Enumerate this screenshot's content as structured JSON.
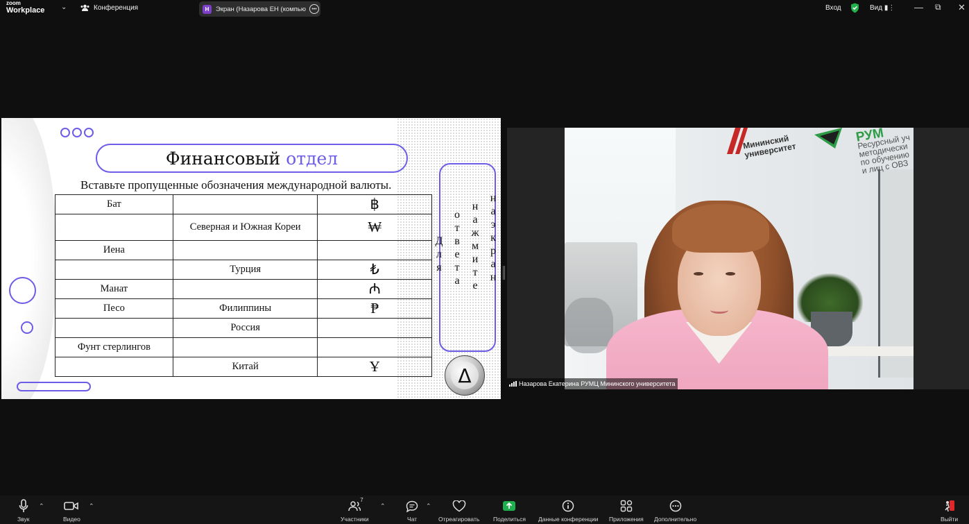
{
  "app": {
    "logo_line1": "zoom",
    "logo_line2": "Workplace",
    "meeting_label": "Конференция",
    "share_tab_letter": "H",
    "share_tab_title": "Экран (Назарова ЕН (компьютер",
    "login_label": "Вход",
    "view_label": "Вид"
  },
  "slide": {
    "title_main": "Финансовый",
    "title_accent": "отдел",
    "subtitle": "Вставьте пропущенные обозначения международной валюты.",
    "rows": [
      {
        "currency": "Бат",
        "country": "",
        "symbol": "฿"
      },
      {
        "currency": "",
        "country": "Северная и Южная Кореи",
        "symbol": "₩"
      },
      {
        "currency": "Иена",
        "country": "",
        "symbol": ""
      },
      {
        "currency": "",
        "country": "Турция",
        "symbol": "₺"
      },
      {
        "currency": "Манат",
        "country": "",
        "symbol": "₼"
      },
      {
        "currency": "Песо",
        "country": "Филиппины",
        "symbol": "₱"
      },
      {
        "currency": "",
        "country": "Россия",
        "symbol": ""
      },
      {
        "currency": "Фунт стерлингов",
        "country": "",
        "symbol": ""
      },
      {
        "currency": "",
        "country": "Китай",
        "symbol": "Ұ"
      }
    ],
    "vertical_words": [
      "Для",
      "ответа",
      "нажмите",
      "на экран"
    ],
    "control_symbol": "Δ",
    "accent_color": "#6c5ce7"
  },
  "video": {
    "participant_name": "Назарова Екатерина РУМЦ Мининского университета",
    "logo_mu_line1": "Мининский",
    "logo_mu_line2": "университет",
    "logo_ruk_big": "РУМ",
    "logo_ruk_lines": [
      "Ресурсный уч",
      "методически",
      "по обучению",
      "и лиц с ОВЗ"
    ]
  },
  "toolbar": {
    "audio": "Звук",
    "video": "Видео",
    "participants": "Участники",
    "participants_count": "7",
    "chat": "Чат",
    "react": "Отреагировать",
    "share": "Поделиться",
    "info": "Данные конференции",
    "apps": "Приложения",
    "more": "Дополнительно",
    "leave": "Выйти",
    "share_color": "#1fae4e",
    "leave_color": "#e02828"
  }
}
